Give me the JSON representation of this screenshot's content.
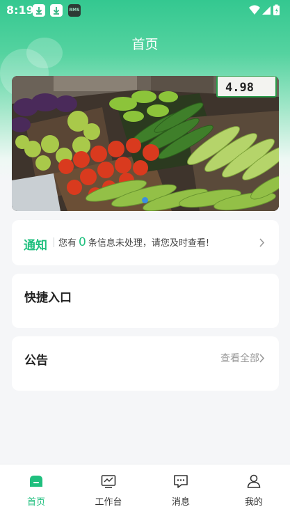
{
  "status_bar": {
    "time": "8:19",
    "rms_label": "RMS",
    "icons": [
      "download-icon",
      "download-icon",
      "app-icon",
      "wifi-icon",
      "signal-icon",
      "battery-icon"
    ]
  },
  "header": {
    "title": "首页"
  },
  "banner": {
    "description": "vegetable market",
    "price_tag": "4.98",
    "active_dot": 1
  },
  "notice": {
    "title": "通知",
    "prefix": "您有",
    "count": "0",
    "suffix": "条信息未处理，请您及时查看!",
    "chevron": "chevron-right-icon"
  },
  "quick_entry": {
    "title": "快捷入口"
  },
  "announcement": {
    "title": "公告",
    "view_all": "查看全部"
  },
  "tabbar": {
    "active": "home",
    "items": [
      {
        "key": "home",
        "label": "首页",
        "icon": "home-icon"
      },
      {
        "key": "workbench",
        "label": "工作台",
        "icon": "workbench-icon"
      },
      {
        "key": "messages",
        "label": "消息",
        "icon": "message-icon"
      },
      {
        "key": "mine",
        "label": "我的",
        "icon": "user-icon"
      }
    ]
  },
  "colors": {
    "accent": "#1fbf7e",
    "header_top": "#34c890",
    "background": "#f5f6f8",
    "card": "#ffffff",
    "text_primary": "#222222",
    "text_muted": "#999999"
  }
}
